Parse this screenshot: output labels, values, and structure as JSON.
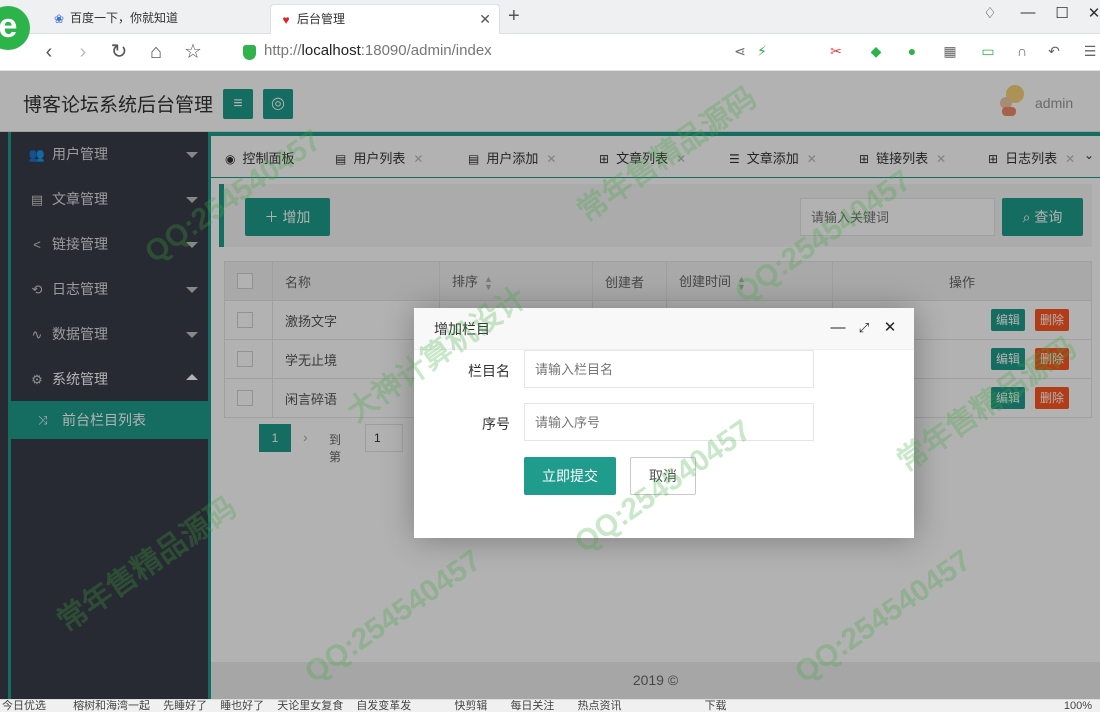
{
  "browser": {
    "tabs": [
      {
        "label": "百度一下，你就知道",
        "icon": "paw-icon"
      },
      {
        "label": "后台管理",
        "icon": "heart-icon"
      }
    ],
    "url_prefix": "http://",
    "url_host": "localhost",
    "url_rest": ":18090/admin/index",
    "zoom": "100%"
  },
  "header": {
    "title": "博客论坛系统后台管理",
    "user": "admin"
  },
  "sidebar": {
    "items": [
      {
        "label": "用户管理",
        "icon": "users-icon"
      },
      {
        "label": "文章管理",
        "icon": "document-icon"
      },
      {
        "label": "链接管理",
        "icon": "share-icon"
      },
      {
        "label": "日志管理",
        "icon": "history-icon"
      },
      {
        "label": "数据管理",
        "icon": "pulse-icon"
      },
      {
        "label": "系统管理",
        "icon": "gears-icon"
      }
    ],
    "sub_active": "前台栏目列表"
  },
  "tabs": [
    {
      "label": "控制面板"
    },
    {
      "label": "用户列表"
    },
    {
      "label": "用户添加"
    },
    {
      "label": "文章列表"
    },
    {
      "label": "文章添加"
    },
    {
      "label": "链接列表"
    },
    {
      "label": "日志列表"
    }
  ],
  "toolbar": {
    "add_label": "增加",
    "search_placeholder": "请输入关键词",
    "search_label": "查询"
  },
  "table": {
    "headers": [
      "名称",
      "排序",
      "创建者",
      "创建时间",
      "操作"
    ],
    "rows": [
      {
        "name": "激扬文字"
      },
      {
        "name": "学无止境"
      },
      {
        "name": "闲言碎语"
      }
    ],
    "edit_label": "编辑",
    "delete_label": "删除"
  },
  "pager": {
    "current": "1",
    "goto_label": "到第",
    "goto_value": "1"
  },
  "footer": "2019 ©",
  "modal": {
    "title": "增加栏目",
    "name_label": "栏目名",
    "name_placeholder": "请输入栏目名",
    "order_label": "序号",
    "order_placeholder": "请输入序号",
    "submit_label": "立即提交",
    "cancel_label": "取消"
  },
  "statusbar": {
    "items": [
      "今日优选",
      "榕树和海湾一起",
      "先睡好了",
      "睡也好了",
      "天论里女复食",
      "自发变革发",
      "快剪辑",
      "每日关注",
      "热点资讯",
      "下载"
    ]
  },
  "watermark": [
    "QQ:254540457",
    "常年售精品源码",
    "大神计算机设计"
  ],
  "colors": {
    "accent": "#1f9c8c",
    "danger": "#ff5722",
    "sidebar": "#393d49"
  }
}
